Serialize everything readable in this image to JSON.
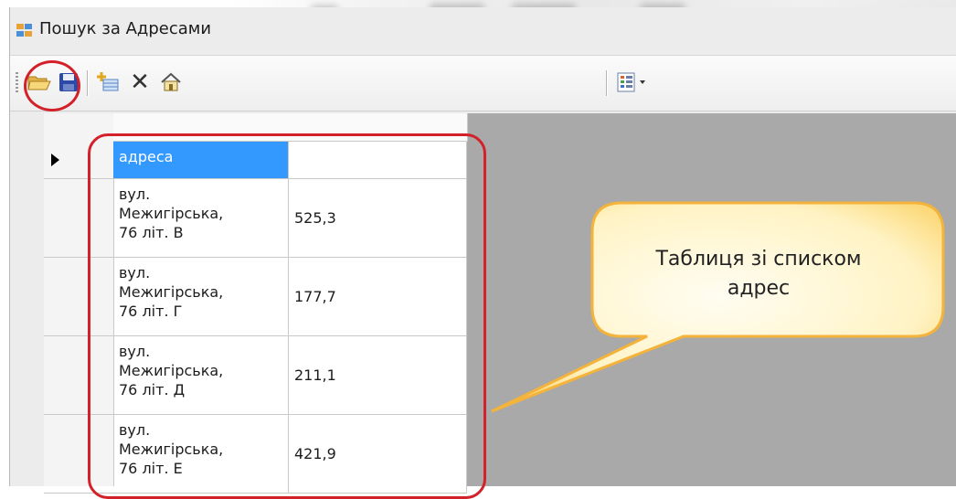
{
  "window": {
    "title": "Пошук за Адресами"
  },
  "toolbar": {
    "icons": [
      "open-folder-icon",
      "save-icon",
      "add-item-icon",
      "delete-icon",
      "home-icon",
      "view-options-icon"
    ],
    "delete_glyph": "✕"
  },
  "table": {
    "header_cell": "адреса",
    "rows": [
      {
        "address_line1": "вул.",
        "address_line2": "Межигірська,",
        "address_line3": "76 літ. В",
        "value": "525,3"
      },
      {
        "address_line1": "вул.",
        "address_line2": "Межигірська,",
        "address_line3": "76 літ. Г",
        "value": "177,7"
      },
      {
        "address_line1": "вул.",
        "address_line2": "Межигірська,",
        "address_line3": "76 літ. Д",
        "value": "211,1"
      },
      {
        "address_line1": "вул.",
        "address_line2": "Межигірська,",
        "address_line3": "76 літ. Е",
        "value": "421,9"
      }
    ]
  },
  "callout": {
    "line1": "Таблиця зі списком",
    "line2": "адрес"
  },
  "colors": {
    "selection": "#3399ff",
    "highlight_red": "#d3212a",
    "callout_fill": "#fff3c4",
    "callout_border": "#f4b33a"
  }
}
